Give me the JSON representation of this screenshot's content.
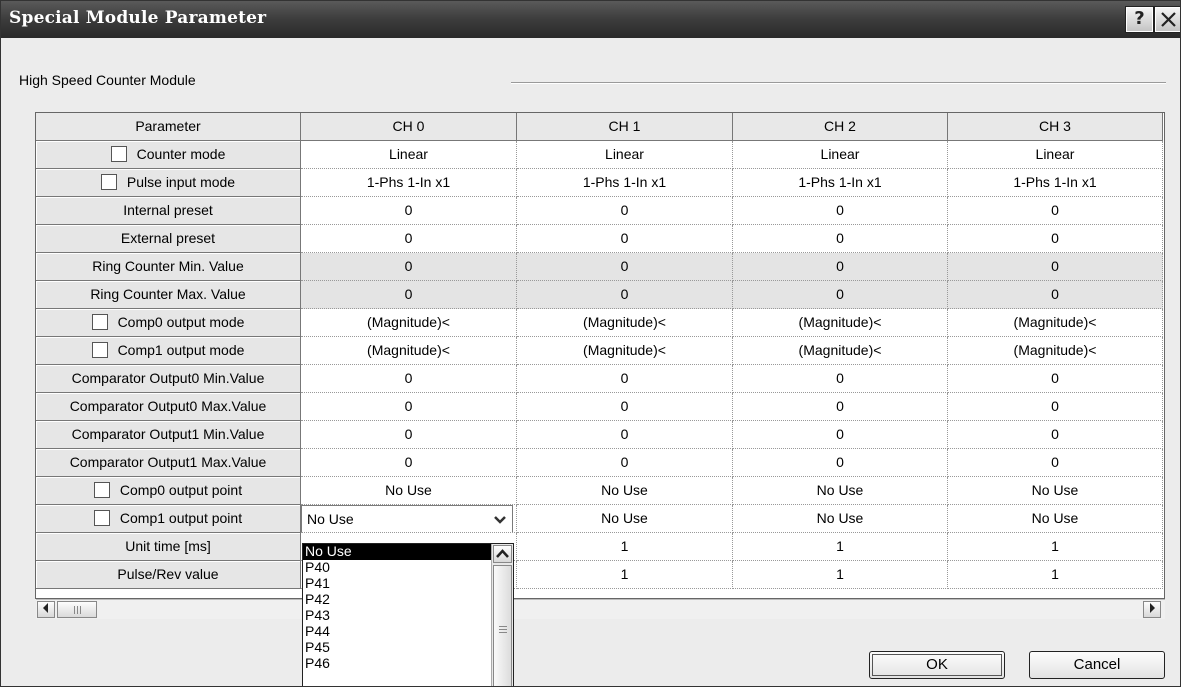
{
  "window": {
    "title": "Special Module Parameter",
    "help_glyph": "?",
    "group_label": "High Speed Counter Module"
  },
  "grid": {
    "headers": [
      "Parameter",
      "CH 0",
      "CH 1",
      "CH 2",
      "CH 3"
    ],
    "rows": [
      {
        "label": "Counter mode",
        "checkbox": true,
        "grey": false,
        "values": [
          "Linear",
          "Linear",
          "Linear",
          "Linear"
        ]
      },
      {
        "label": "Pulse input mode",
        "checkbox": true,
        "grey": false,
        "values": [
          "1-Phs 1-In x1",
          "1-Phs 1-In x1",
          "1-Phs 1-In x1",
          "1-Phs 1-In x1"
        ]
      },
      {
        "label": "Internal preset",
        "checkbox": false,
        "grey": false,
        "values": [
          "0",
          "0",
          "0",
          "0"
        ]
      },
      {
        "label": "External preset",
        "checkbox": false,
        "grey": false,
        "values": [
          "0",
          "0",
          "0",
          "0"
        ]
      },
      {
        "label": "Ring Counter Min. Value",
        "checkbox": false,
        "grey": true,
        "values": [
          "0",
          "0",
          "0",
          "0"
        ]
      },
      {
        "label": "Ring Counter Max. Value",
        "checkbox": false,
        "grey": true,
        "values": [
          "0",
          "0",
          "0",
          "0"
        ]
      },
      {
        "label": "Comp0 output mode",
        "checkbox": true,
        "grey": false,
        "values": [
          "(Magnitude)<",
          "(Magnitude)<",
          "(Magnitude)<",
          "(Magnitude)<"
        ]
      },
      {
        "label": "Comp1 output mode",
        "checkbox": true,
        "grey": false,
        "values": [
          "(Magnitude)<",
          "(Magnitude)<",
          "(Magnitude)<",
          "(Magnitude)<"
        ]
      },
      {
        "label": "Comparator Output0 Min.Value",
        "checkbox": false,
        "grey": false,
        "values": [
          "0",
          "0",
          "0",
          "0"
        ]
      },
      {
        "label": "Comparator Output0 Max.Value",
        "checkbox": false,
        "grey": false,
        "values": [
          "0",
          "0",
          "0",
          "0"
        ]
      },
      {
        "label": "Comparator Output1 Min.Value",
        "checkbox": false,
        "grey": false,
        "values": [
          "0",
          "0",
          "0",
          "0"
        ]
      },
      {
        "label": "Comparator Output1 Max.Value",
        "checkbox": false,
        "grey": false,
        "values": [
          "0",
          "0",
          "0",
          "0"
        ]
      },
      {
        "label": "Comp0 output point",
        "checkbox": true,
        "grey": false,
        "values": [
          "No Use",
          "No Use",
          "No Use",
          "No Use"
        ]
      },
      {
        "label": "Comp1 output point",
        "checkbox": true,
        "grey": false,
        "values": [
          "No Use",
          "No Use",
          "No Use",
          "No Use"
        ]
      },
      {
        "label": "Unit time [ms]",
        "checkbox": false,
        "grey": false,
        "values": [
          "",
          "1",
          "1",
          "1"
        ]
      },
      {
        "label": "Pulse/Rev value",
        "checkbox": false,
        "grey": false,
        "values": [
          "",
          "1",
          "1",
          "1"
        ]
      }
    ]
  },
  "combo": {
    "value": "No Use",
    "options": [
      "No Use",
      "P40",
      "P41",
      "P42",
      "P43",
      "P44",
      "P45",
      "P46"
    ],
    "selected_index": 0
  },
  "buttons": {
    "ok": "OK",
    "cancel": "Cancel"
  }
}
